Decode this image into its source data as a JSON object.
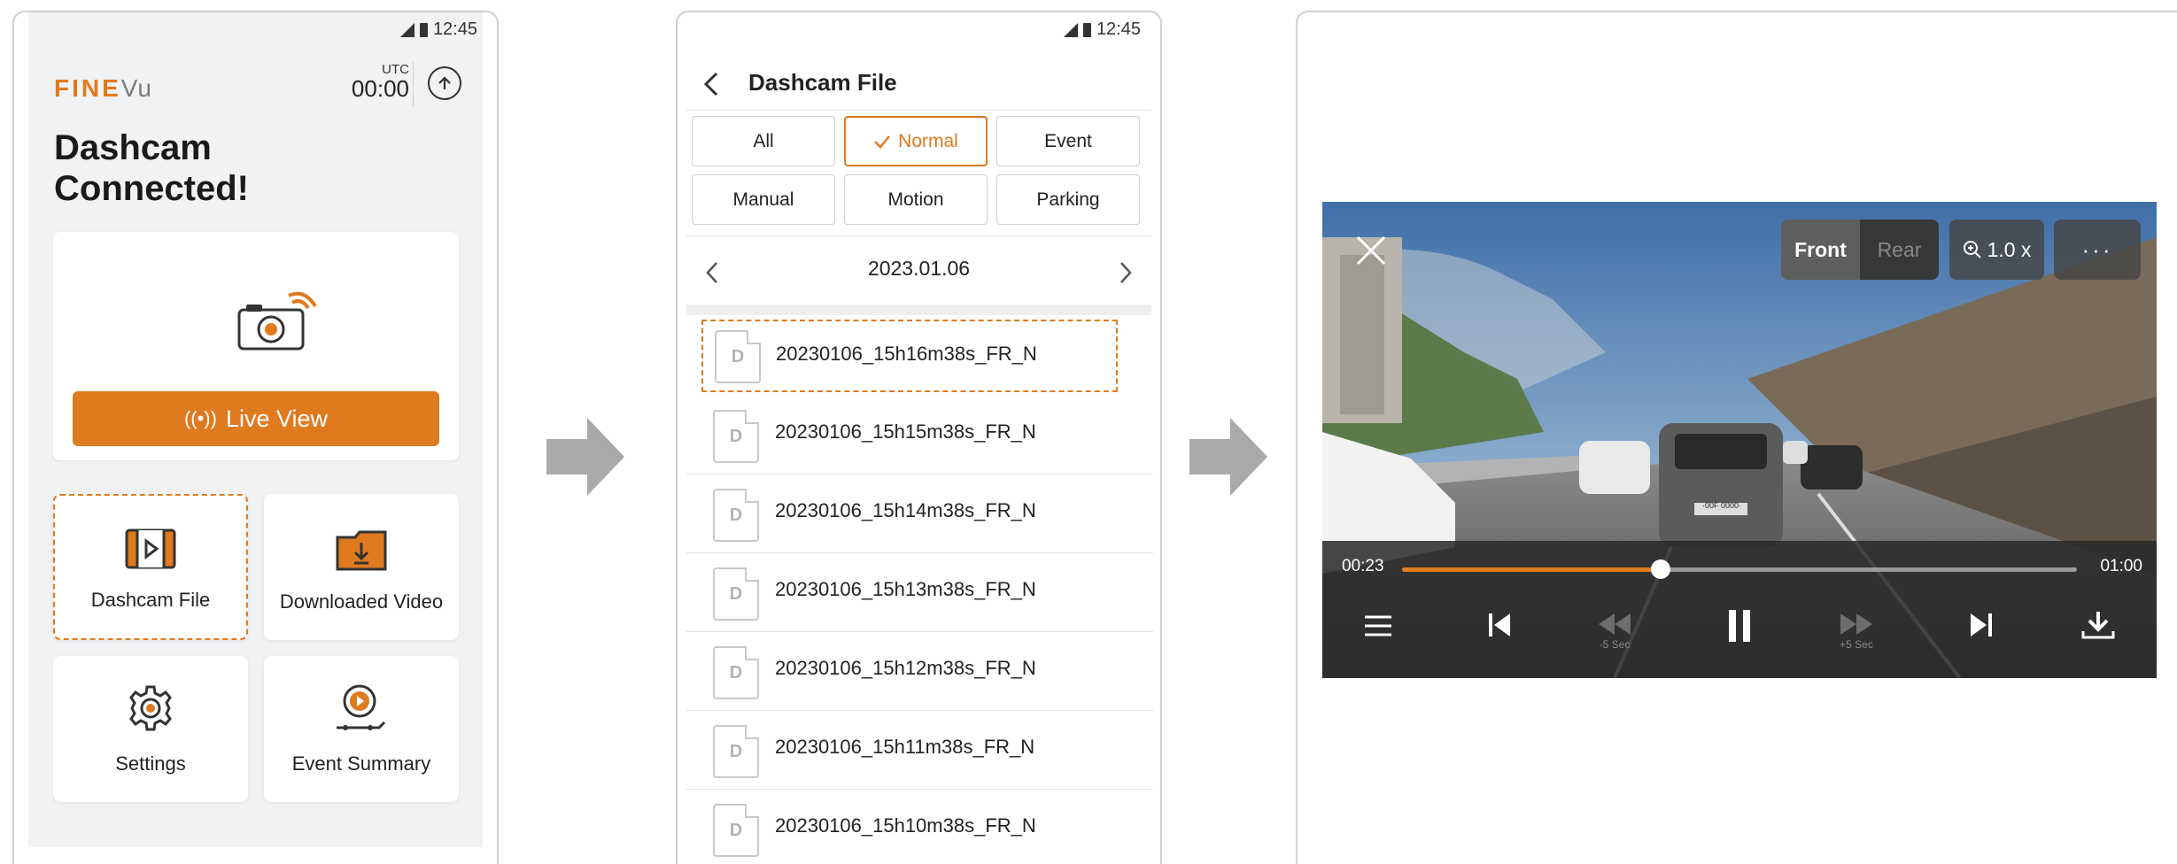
{
  "status": {
    "time": "12:45"
  },
  "home": {
    "brand_main": "FINE",
    "brand_sub": "Vu",
    "utc_label": "UTC",
    "utc_time": "00:00",
    "headline": "Dashcam Connected!",
    "live_view": "Live View",
    "tiles": [
      "Dashcam File",
      "Downloaded Video",
      "Settings",
      "Event Summary"
    ]
  },
  "files": {
    "title": "Dashcam File",
    "filters": [
      "All",
      "Normal",
      "Event",
      "Manual",
      "Motion",
      "Parking"
    ],
    "active_filter": "Normal",
    "date": "2023.01.06",
    "doc_letter": "D",
    "items": [
      "20230106_15h16m38s_FR_N",
      "20230106_15h15m38s_FR_N",
      "20230106_15h14m38s_FR_N",
      "20230106_15h13m38s_FR_N",
      "20230106_15h12m38s_FR_N",
      "20230106_15h11m38s_FR_N",
      "20230106_15h10m38s_FR_N"
    ]
  },
  "player": {
    "front": "Front",
    "rear": "Rear",
    "zoom": "1.0 x",
    "more": "···",
    "elapsed": "00:23",
    "duration": "01:00",
    "progress": 0.383,
    "back_label": "-5 Sec",
    "fwd_label": "+5 Sec",
    "plate": "·00F 0000·"
  },
  "colors": {
    "accent": "#e07a1e",
    "arrow": "#a9a9a9"
  }
}
